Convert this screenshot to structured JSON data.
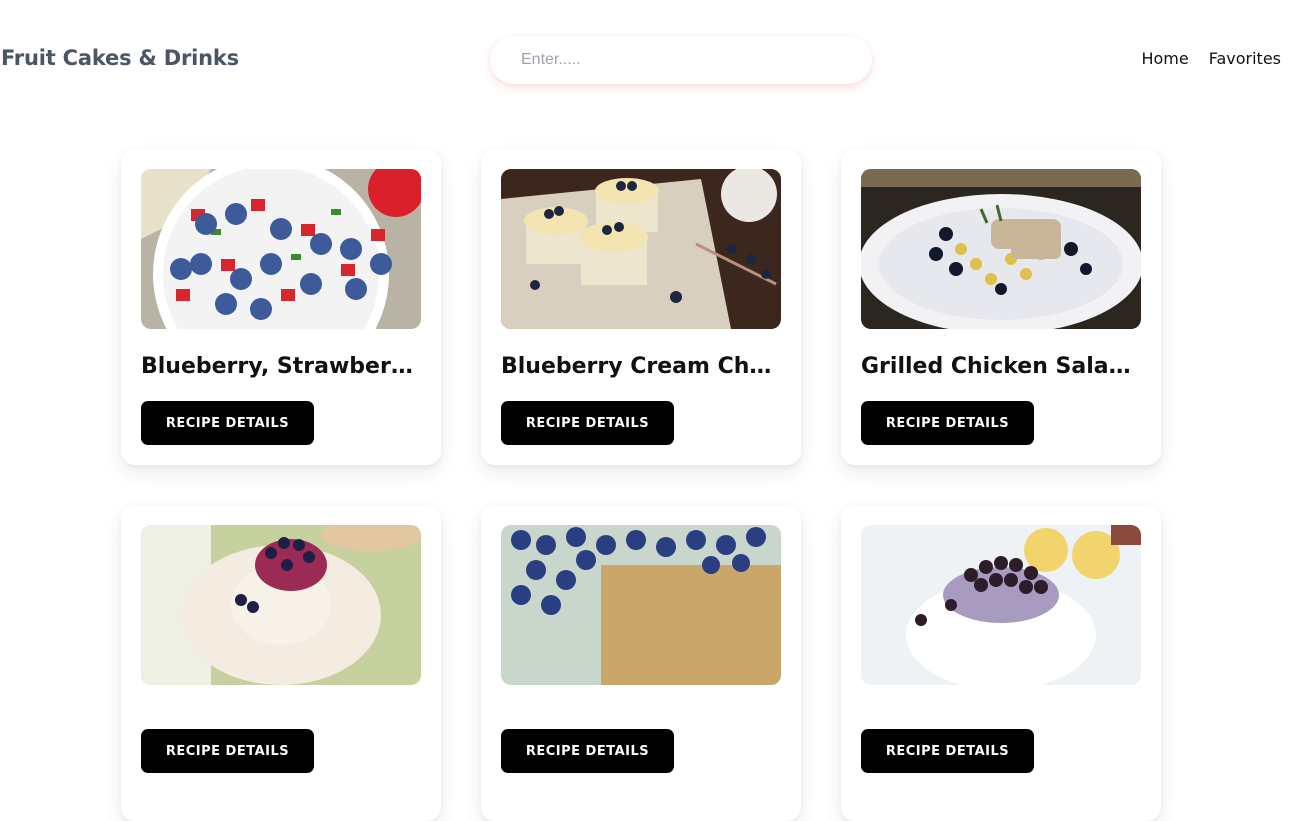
{
  "header": {
    "brand": "Fruit Cakes & Drinks",
    "search": {
      "placeholder": "Enter.....",
      "value": ""
    },
    "nav": [
      {
        "label": "Home"
      },
      {
        "label": "Favorites"
      }
    ]
  },
  "recipes": [
    {
      "title": "Blueberry, Strawberry ...",
      "button": "RECIPE DETAILS"
    },
    {
      "title": "Blueberry Cream Chee...",
      "button": "RECIPE DETAILS"
    },
    {
      "title": "Grilled Chicken Salad ...",
      "button": "RECIPE DETAILS"
    },
    {
      "title": "",
      "button": "RECIPE DETAILS"
    },
    {
      "title": "",
      "button": "RECIPE DETAILS"
    },
    {
      "title": "",
      "button": "RECIPE DETAILS"
    }
  ]
}
